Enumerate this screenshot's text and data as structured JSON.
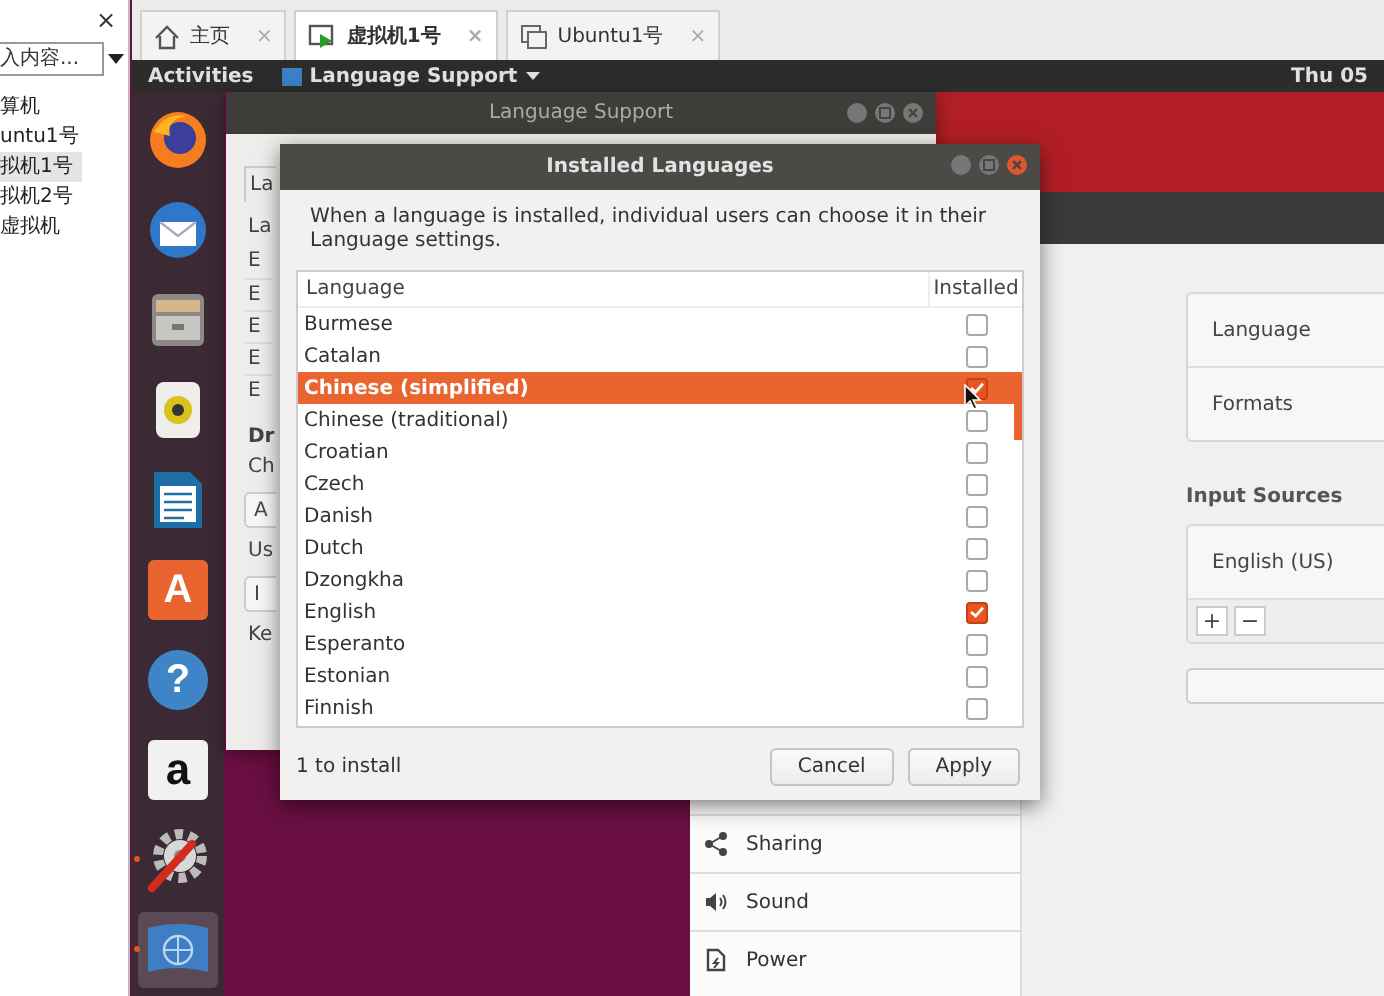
{
  "library": {
    "close": "×",
    "search": {
      "placeholder": "入内容..."
    },
    "items": [
      {
        "label": "算机",
        "selected": false
      },
      {
        "label": "untu1号",
        "selected": false
      },
      {
        "label": "拟机1号",
        "selected": true
      },
      {
        "label": "拟机2号",
        "selected": false
      },
      {
        "label": "虚拟机",
        "selected": false
      }
    ]
  },
  "tabs": [
    {
      "label": "主页",
      "kind": "home",
      "close": "×",
      "selected": false
    },
    {
      "label": "虚拟机1号",
      "kind": "vm-running",
      "close": "×",
      "selected": true
    },
    {
      "label": "Ubuntu1号",
      "kind": "vm",
      "close": "×",
      "selected": false
    }
  ],
  "top_bar": {
    "activities": "Activities",
    "app_menu": "Language Support",
    "clock": "Thu 05"
  },
  "dock": [
    {
      "kind": "firefox",
      "running": false,
      "selected": false
    },
    {
      "kind": "mail",
      "running": false,
      "selected": false
    },
    {
      "kind": "files",
      "running": false,
      "selected": false
    },
    {
      "kind": "speaker",
      "running": false,
      "selected": false
    },
    {
      "kind": "writer",
      "running": false,
      "selected": false
    },
    {
      "kind": "software",
      "glyph": "A",
      "running": false,
      "selected": false
    },
    {
      "kind": "help",
      "glyph": "?",
      "running": false,
      "selected": false
    },
    {
      "kind": "amazon",
      "glyph": "a",
      "running": false,
      "selected": false
    },
    {
      "kind": "tools",
      "running": true,
      "selected": false
    },
    {
      "kind": "language",
      "running": true,
      "selected": true
    }
  ],
  "language_support": {
    "title": "Language Support",
    "fragments": [
      {
        "kind": "tab",
        "text": "La"
      },
      {
        "kind": "text",
        "text": "La"
      },
      {
        "kind": "row",
        "text": "E"
      },
      {
        "kind": "row",
        "text": "E"
      },
      {
        "kind": "row",
        "text": "E"
      },
      {
        "kind": "row",
        "text": "E"
      },
      {
        "kind": "row",
        "text": "E"
      },
      {
        "kind": "heading",
        "text": "Dr"
      },
      {
        "kind": "text",
        "text": "Ch"
      },
      {
        "kind": "button",
        "text": "A"
      },
      {
        "kind": "text",
        "text": "Us"
      },
      {
        "kind": "button",
        "text": "I"
      },
      {
        "kind": "text",
        "text": "Ke"
      }
    ]
  },
  "dialog": {
    "title": "Installed Languages",
    "description": "When a language is installed, individual users can choose it in their Language settings.",
    "columns": [
      "Language",
      "Installed"
    ],
    "rows": [
      {
        "language": "Burmese",
        "installed": false,
        "selected": false
      },
      {
        "language": "Catalan",
        "installed": false,
        "selected": false
      },
      {
        "language": "Chinese (simplified)",
        "installed": true,
        "selected": true
      },
      {
        "language": "Chinese (traditional)",
        "installed": false,
        "selected": false
      },
      {
        "language": "Croatian",
        "installed": false,
        "selected": false
      },
      {
        "language": "Czech",
        "installed": false,
        "selected": false
      },
      {
        "language": "Danish",
        "installed": false,
        "selected": false
      },
      {
        "language": "Dutch",
        "installed": false,
        "selected": false
      },
      {
        "language": "Dzongkha",
        "installed": false,
        "selected": false
      },
      {
        "language": "English",
        "installed": true,
        "selected": false
      },
      {
        "language": "Esperanto",
        "installed": false,
        "selected": false
      },
      {
        "language": "Estonian",
        "installed": false,
        "selected": false
      },
      {
        "language": "Finnish",
        "installed": false,
        "selected": false
      }
    ],
    "status": "1 to install",
    "buttons": [
      "Cancel",
      "Apply"
    ]
  },
  "settings": {
    "region_items": [
      "Language",
      "Formats"
    ],
    "input_sources_heading": "Input Sources",
    "input_sources": [
      "English (US)"
    ],
    "add": "+",
    "remove": "−",
    "sidebar": [
      {
        "label": "Sharing",
        "kind": "sharing"
      },
      {
        "label": "Sound",
        "kind": "sound"
      },
      {
        "label": "Power",
        "kind": "power"
      }
    ]
  }
}
